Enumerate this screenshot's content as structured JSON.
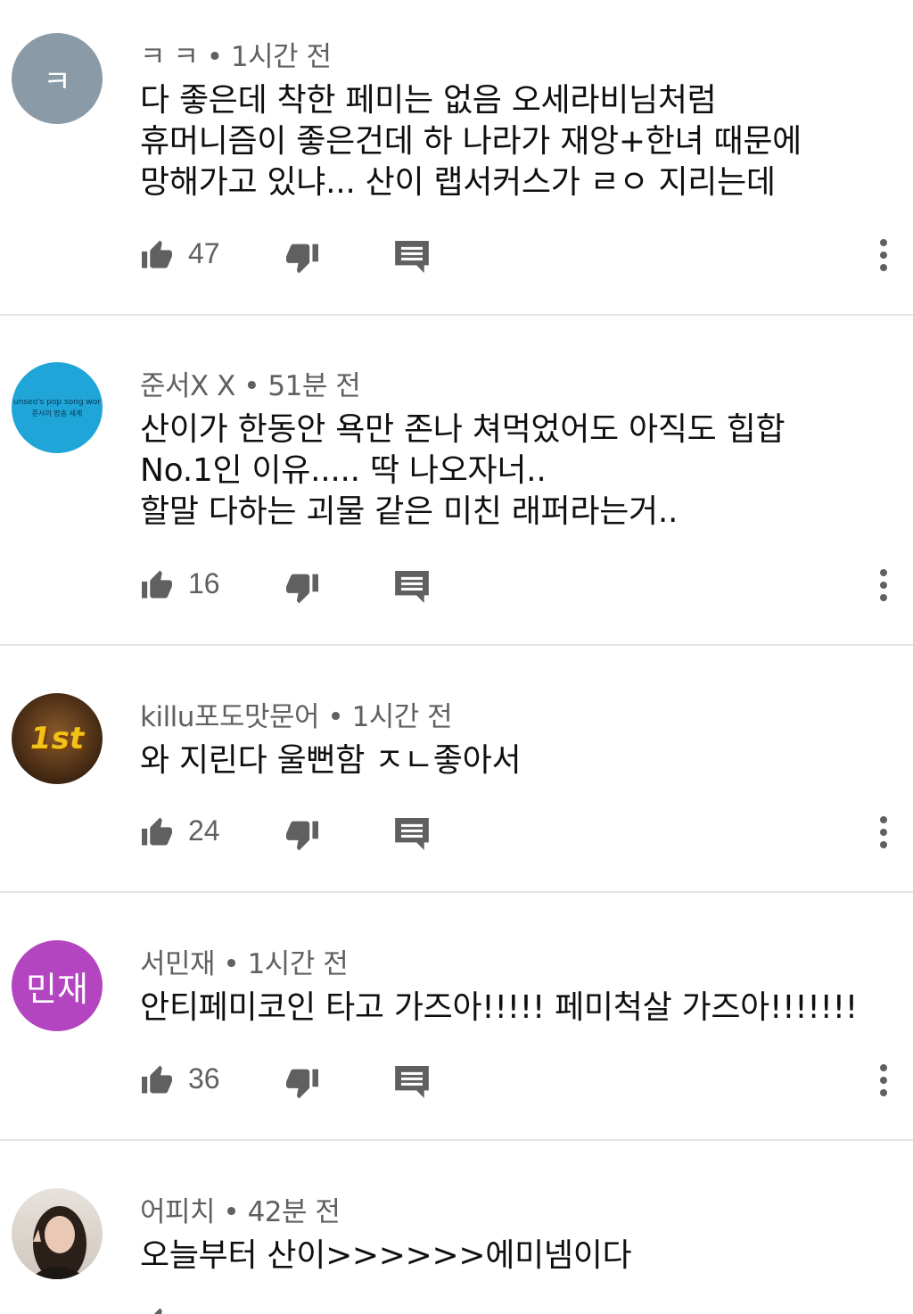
{
  "comments": [
    {
      "avatar": {
        "text": "ㅋ",
        "bg": "#8a9aa6"
      },
      "author": "ㅋ ㅋ",
      "time": "1시간 전",
      "text": "다 좋은데 착한 페미는 없음 오세라비님처럼\n휴머니즘이 좋은건데 하 나라가 재앙+한녀 때문에\n망해가고 있냐... 산이 랩서커스가 ㄹㅇ 지리는데",
      "likes": "47"
    },
    {
      "avatar": {
        "text": "",
        "line1": "unseo's pop song wor",
        "line2": "준서의 팝송 세계",
        "bg": "#1fa5d8"
      },
      "author": "준서X X",
      "time": "51분 전",
      "text": "산이가 한동안 욕만 존나 쳐먹었어도 아직도 힙합\nNo.1인 이유..... 딱 나오자너..\n할말 다하는 괴물 같은 미친 래퍼라는거..",
      "likes": "16"
    },
    {
      "avatar": {
        "text": "1st",
        "bg": "#5a3b1c"
      },
      "author": "killu포도맛문어",
      "time": "1시간 전",
      "text": "와 지린다 울뻔함 ㅈㄴ좋아서",
      "likes": "24"
    },
    {
      "avatar": {
        "text": "민재",
        "bg": "#b445c0"
      },
      "author": "서민재",
      "time": "1시간 전",
      "text": "안티페미코인 타고 가즈아!!!!! 페미척살 가즈아!!!!!!!",
      "likes": "36"
    },
    {
      "avatar": {
        "text": "",
        "bg": "#c9c2bb"
      },
      "author": "어피치",
      "time": "42분 전",
      "text": "오늘부터 산이>>>>>>에미넴이다",
      "likes": ""
    }
  ],
  "separator": "•",
  "colors": {
    "secondary": "#606060",
    "primary": "#0f0f0f",
    "divider": "#e5e5e5"
  }
}
